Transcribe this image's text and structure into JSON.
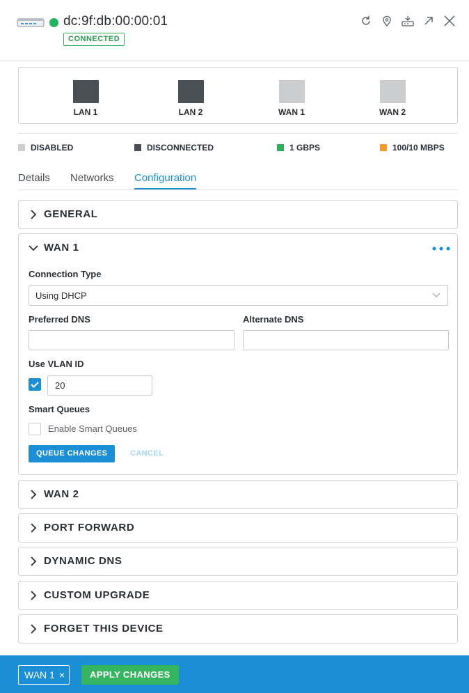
{
  "header": {
    "device_mac": "dc:9f:db:00:00:01",
    "status_badge": "CONNECTED",
    "status_color": "#22b55e",
    "device_icon": "router-device-icon",
    "actions": [
      "refresh-icon",
      "locate-icon",
      "device-manage-icon",
      "expand-icon",
      "close-icon"
    ]
  },
  "ports": [
    {
      "label": "LAN 1",
      "state": "disconnected"
    },
    {
      "label": "LAN 2",
      "state": "disconnected"
    },
    {
      "label": "WAN 1",
      "state": "disabled"
    },
    {
      "label": "WAN 2",
      "state": "disabled"
    }
  ],
  "legend": {
    "disabled": "DISABLED",
    "disconnected": "DISCONNECTED",
    "gbps": "1 GBPS",
    "mbps": "100/10 MBPS",
    "colors": {
      "disabled": "#cbcdcf",
      "disconnected": "#4a4f55",
      "gbps": "#2db25a",
      "mbps": "#f39a2b"
    }
  },
  "tabs": {
    "details": "Details",
    "networks": "Networks",
    "configuration": "Configuration",
    "active": "Configuration"
  },
  "sections": {
    "general": "GENERAL",
    "wan1": "WAN 1",
    "wan2": "WAN 2",
    "port_forward": "PORT FORWARD",
    "dynamic_dns": "DYNAMIC DNS",
    "custom_upgrade": "CUSTOM UPGRADE",
    "forget_device": "FORGET THIS DEVICE"
  },
  "wan1_form": {
    "connection_type_label": "Connection Type",
    "connection_type_value": "Using DHCP",
    "preferred_dns_label": "Preferred DNS",
    "preferred_dns_value": "",
    "alternate_dns_label": "Alternate DNS",
    "alternate_dns_value": "",
    "vlan_label": "Use VLAN ID",
    "vlan_checked": true,
    "vlan_value": "20",
    "smart_queues_label": "Smart Queues",
    "enable_smart_queues_label": "Enable Smart Queues",
    "smart_queues_checked": false,
    "queue_changes": "QUEUE CHANGES",
    "cancel": "CANCEL"
  },
  "footer": {
    "pending_chip": "WAN 1",
    "chip_close": "×",
    "apply_changes": "APPLY CHANGES"
  }
}
